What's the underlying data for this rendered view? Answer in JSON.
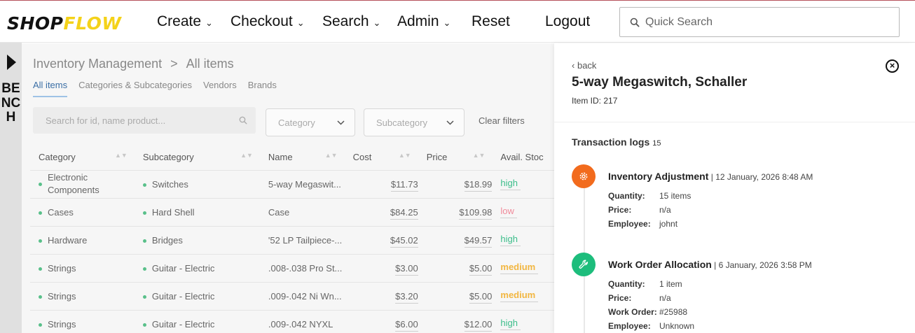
{
  "logo": {
    "part1": "SHOP",
    "part2": "FLOW"
  },
  "nav": [
    {
      "label": "Create",
      "dropdown": true
    },
    {
      "label": "Checkout",
      "dropdown": true
    },
    {
      "label": "Search",
      "dropdown": true
    },
    {
      "label": "Admin",
      "dropdown": true
    },
    {
      "label": "Reset",
      "dropdown": false
    },
    {
      "label": "Logout",
      "dropdown": false
    }
  ],
  "quick_search": {
    "placeholder": "Quick Search"
  },
  "bench": {
    "label": "BENCH"
  },
  "breadcrumb": {
    "parent": "Inventory Management",
    "separator": ">",
    "current": "All items"
  },
  "tabs": [
    "All items",
    "Categories & Subcategories",
    "Vendors",
    "Brands"
  ],
  "filters": {
    "search_placeholder": "Search for id, name product...",
    "category": "Category",
    "subcategory": "Subcategory",
    "clear": "Clear filters"
  },
  "table": {
    "headers": [
      "Category",
      "Subcategory",
      "Name",
      "Cost",
      "Price",
      "Avail. Stoc"
    ],
    "rows": [
      {
        "category": "Electronic Components",
        "subcategory": "Switches",
        "name": "5-way Megaswit...",
        "cost": "$11.73",
        "price": "$18.99",
        "stock": "high"
      },
      {
        "category": "Cases",
        "subcategory": "Hard Shell",
        "name": "Case",
        "cost": "$84.25",
        "price": "$109.98",
        "stock": "low"
      },
      {
        "category": "Hardware",
        "subcategory": "Bridges",
        "name": "'52 LP Tailpiece-...",
        "cost": "$45.02",
        "price": "$49.57",
        "stock": "high"
      },
      {
        "category": "Strings",
        "subcategory": "Guitar - Electric",
        "name": ".008-.038 Pro St...",
        "cost": "$3.00",
        "price": "$5.00",
        "stock": "medium"
      },
      {
        "category": "Strings",
        "subcategory": "Guitar - Electric",
        "name": ".009-.042 Ni Wn...",
        "cost": "$3.20",
        "price": "$5.00",
        "stock": "medium"
      },
      {
        "category": "Strings",
        "subcategory": "Guitar - Electric",
        "name": ".009-.042 NYXL",
        "cost": "$6.00",
        "price": "$12.00",
        "stock": "high"
      }
    ]
  },
  "colors": {
    "high": "#3bbd8a",
    "low": "#f08a9a",
    "medium": "#f2b640",
    "accent": "#3a6ea5",
    "adjustment": "#f26b1d",
    "allocation": "#1dbd7c"
  },
  "panel": {
    "back": "back",
    "title": "5-way Megaswitch, Schaller",
    "item_id": "Item ID: 217",
    "log_heading": "Transaction logs",
    "log_count": "15",
    "logs": [
      {
        "icon": "gear-icon",
        "title": "Inventory Adjustment",
        "date": "12 January, 2026 8:48 AM",
        "fields": [
          {
            "k": "Quantity:",
            "v": "15 items"
          },
          {
            "k": "Price:",
            "v": "n/a"
          },
          {
            "k": "Employee:",
            "v": "johnt"
          }
        ]
      },
      {
        "icon": "wrench-icon",
        "title": "Work Order Allocation",
        "date": "6 January, 2026 3:58 PM",
        "fields": [
          {
            "k": "Quantity:",
            "v": "1 item"
          },
          {
            "k": "Price:",
            "v": "n/a"
          },
          {
            "k": "Work Order:",
            "v": "#25988"
          },
          {
            "k": "Employee:",
            "v": "Unknown"
          }
        ]
      }
    ]
  }
}
